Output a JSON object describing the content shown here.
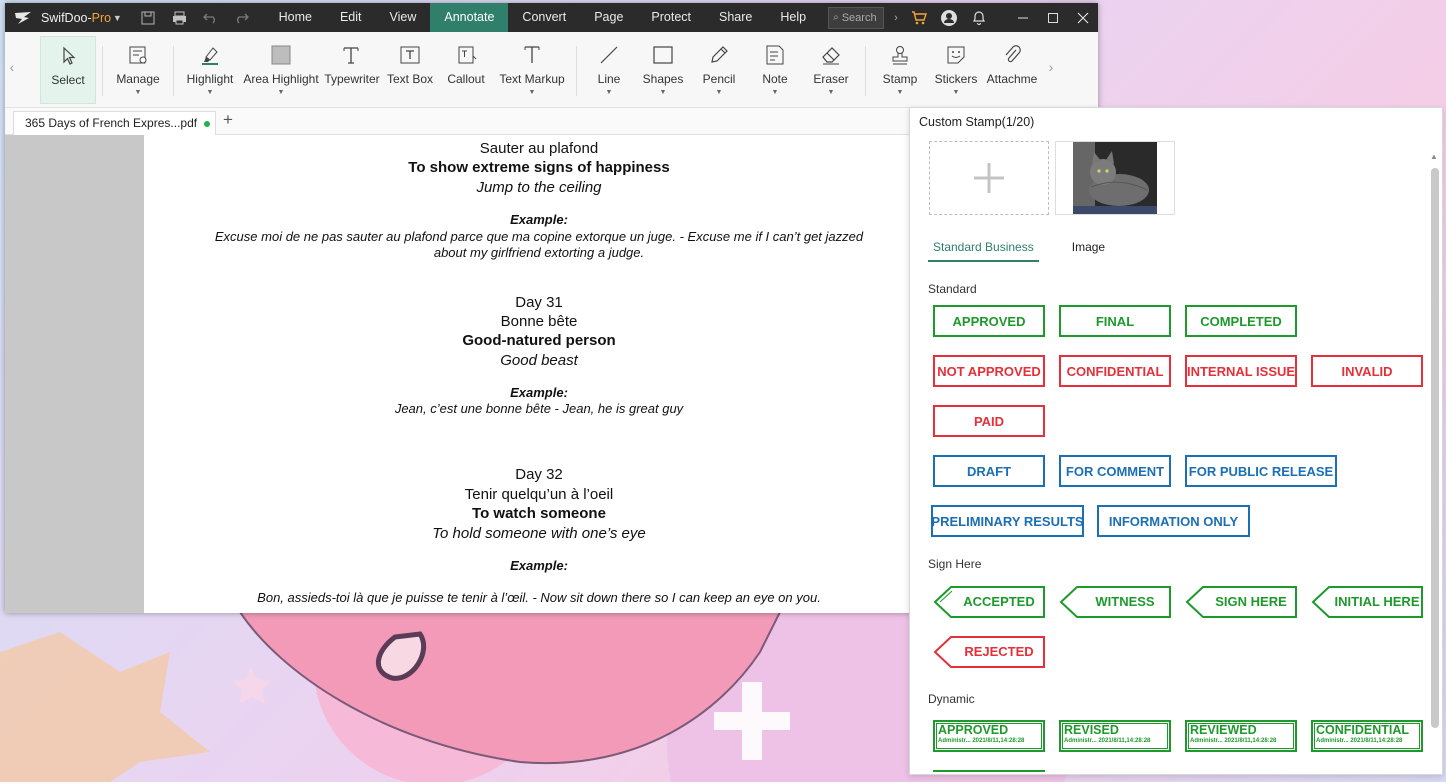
{
  "app": {
    "brand_name": "SwifDoo-",
    "brand_suffix": "Pro",
    "menu": [
      "Home",
      "Edit",
      "View",
      "Annotate",
      "Convert",
      "Page",
      "Protect",
      "Share",
      "Help"
    ],
    "active_menu": "Annotate",
    "search_placeholder": "Search",
    "accent_color": "#2f7f6a"
  },
  "ribbon": {
    "tools": [
      {
        "label": "Select",
        "icon": "cursor-icon",
        "active": true
      },
      {
        "label": "Manage",
        "icon": "manage-icon",
        "caret": true
      },
      {
        "label": "Highlight",
        "icon": "highlighter-icon",
        "caret": true
      },
      {
        "label": "Area Highlight",
        "icon": "area-highlight-icon",
        "caret": true
      },
      {
        "label": "Typewriter",
        "icon": "typewriter-icon"
      },
      {
        "label": "Text Box",
        "icon": "text-box-icon"
      },
      {
        "label": "Callout",
        "icon": "callout-icon"
      },
      {
        "label": "Text Markup",
        "icon": "text-markup-icon",
        "caret": true
      },
      {
        "label": "Line",
        "icon": "line-icon",
        "caret": true
      },
      {
        "label": "Shapes",
        "icon": "shapes-icon",
        "caret": true
      },
      {
        "label": "Pencil",
        "icon": "pencil-icon",
        "caret": true
      },
      {
        "label": "Note",
        "icon": "note-icon",
        "caret": true
      },
      {
        "label": "Eraser",
        "icon": "eraser-icon",
        "caret": true
      },
      {
        "label": "Stamp",
        "icon": "stamp-icon",
        "caret": true
      },
      {
        "label": "Stickers",
        "icon": "stickers-icon",
        "caret": true
      },
      {
        "label": "Attachme",
        "icon": "attachment-icon"
      }
    ]
  },
  "tabs": {
    "document": "365 Days of French Expres...pdf"
  },
  "document": {
    "lines": [
      {
        "text": "Sauter au plafond",
        "style": "n"
      },
      {
        "text": "To show extreme signs of happiness",
        "style": "b"
      },
      {
        "text": "Jump to the ceiling",
        "style": "i"
      },
      {
        "text": "Example:",
        "style": "eh"
      },
      {
        "text": "Excuse moi de ne pas sauter au plafond parce que ma copine extorque un juge. - Excuse me if I can’t get jazzed",
        "style": "ex"
      },
      {
        "text": "about my girlfriend extorting a judge.",
        "style": "ex"
      },
      {
        "text": "Day 31",
        "style": "n"
      },
      {
        "text": "Bonne bête",
        "style": "n"
      },
      {
        "text": "Good-natured person",
        "style": "b"
      },
      {
        "text": "Good beast",
        "style": "i"
      },
      {
        "text": "Example:",
        "style": "eh"
      },
      {
        "text": "Jean, c’est une bonne bête - Jean, he is great guy",
        "style": "ex"
      },
      {
        "text": "Day 32",
        "style": "n"
      },
      {
        "text": "Tenir quelqu’un à l’oeil",
        "style": "n"
      },
      {
        "text": "To watch someone",
        "style": "b"
      },
      {
        "text": "To hold someone with one’s eye",
        "style": "i"
      },
      {
        "text": "Example:",
        "style": "eh"
      },
      {
        "text": "Bon, assieds-toi là que je puisse te tenir à l’œil. - Now sit down there so I can keep an eye on you.",
        "style": "ex"
      }
    ]
  },
  "stamp_panel": {
    "title": "Custom Stamp(1/20)",
    "tabs": [
      "Standard Business",
      "Image"
    ],
    "active_tab": "Standard Business",
    "sections": {
      "standard": "Standard",
      "sign_here": "Sign Here",
      "dynamic": "Dynamic"
    },
    "standard_stamps": [
      {
        "label": "APPROVED",
        "color": "green"
      },
      {
        "label": "FINAL",
        "color": "green"
      },
      {
        "label": "COMPLETED",
        "color": "green"
      },
      {
        "label": "NOT APPROVED",
        "color": "red"
      },
      {
        "label": "CONFIDENTIAL",
        "color": "red"
      },
      {
        "label": "INTERNAL ISSUE",
        "color": "red"
      },
      {
        "label": "INVALID",
        "color": "red"
      },
      {
        "label": "PAID",
        "color": "red"
      },
      {
        "label": "DRAFT",
        "color": "blue"
      },
      {
        "label": "FOR COMMENT",
        "color": "blue"
      },
      {
        "label": "FOR PUBLIC RELEASE",
        "color": "blue"
      },
      {
        "label": "PRELIMINARY RESULTS",
        "color": "blue"
      },
      {
        "label": "INFORMATION ONLY",
        "color": "blue"
      }
    ],
    "sign_stamps": [
      {
        "label": "ACCEPTED",
        "color": "green"
      },
      {
        "label": "WITNESS",
        "color": "green"
      },
      {
        "label": "SIGN HERE",
        "color": "green"
      },
      {
        "label": "INITIAL HERE",
        "color": "green"
      },
      {
        "label": "REJECTED",
        "color": "red"
      }
    ],
    "dynamic_stamps": [
      {
        "label": "APPROVED",
        "meta": "Administr...     2021/8/11,14:28:28"
      },
      {
        "label": "REVISED",
        "meta": "Administr...     2021/8/11,14:28:28"
      },
      {
        "label": "REVIEWED",
        "meta": "Administr...     2021/8/11,14:28:28"
      },
      {
        "label": "CONFIDENTIAL",
        "meta": "Administr...     2021/8/11,14:28:28"
      }
    ],
    "colors": {
      "green": "#1e9a2c",
      "red": "#e5303a",
      "blue": "#1a6fb5"
    }
  }
}
